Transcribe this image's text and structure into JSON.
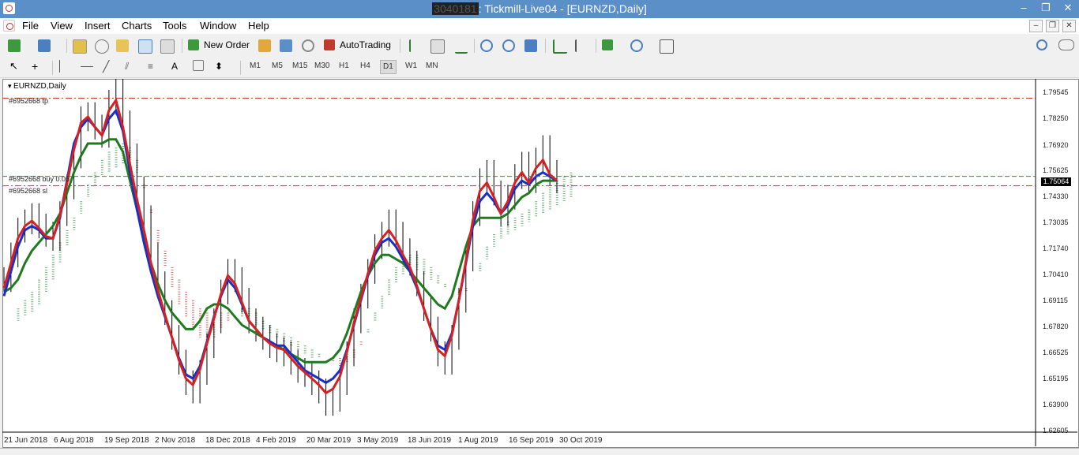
{
  "window": {
    "title_redacted": "3040181",
    "title_rest": ": Tickmill-Live04 - [EURNZD,Daily]",
    "minimize": "–",
    "maximize": "❐",
    "close": "✕"
  },
  "menu": [
    "File",
    "View",
    "Insert",
    "Charts",
    "Tools",
    "Window",
    "Help"
  ],
  "toolbar": {
    "new_order": "New Order",
    "autotrading": "AutoTrading"
  },
  "timeframes": [
    "M1",
    "M5",
    "M15",
    "M30",
    "H1",
    "H4",
    "D1",
    "W1",
    "MN"
  ],
  "active_timeframe": "D1",
  "colors": {
    "titlebar": "#5b8fc7",
    "tp_line": "#c0392b",
    "buy_line": "#2e8b3e",
    "sl_line": "#c0392b",
    "tenkan": "#d82020",
    "kijun": "#1a2fc7",
    "senkou": "#1f7a1f"
  },
  "chart_data": {
    "type": "line",
    "title": "EURNZD,Daily",
    "symbol": "EURNZD",
    "period": "Daily",
    "orders": [
      {
        "label": "#6952668 tp",
        "price": 1.788
      },
      {
        "label": "#6952668 buy 0.05",
        "price": 1.7501
      },
      {
        "label": "#6952668 sl",
        "price": 1.7455
      }
    ],
    "current_price": "1.75064",
    "price_ticks": [
      "1.79545",
      "1.78250",
      "1.76920",
      "1.75625",
      "1.74330",
      "1.73035",
      "1.71740",
      "1.70410",
      "1.69115",
      "1.67820",
      "1.66525",
      "1.65195",
      "1.63900",
      "1.62605"
    ],
    "date_ticks": [
      "21 Jun 2018",
      "6 Aug 2018",
      "19 Sep 2018",
      "2 Nov 2018",
      "18 Dec 2018",
      "4 Feb 2019",
      "20 Mar 2019",
      "3 May 2019",
      "18 Jun 2019",
      "1 Aug 2019",
      "16 Sep 2019",
      "30 Oct 2019"
    ],
    "ylim": [
      1.62605,
      1.79545
    ],
    "close_series": [
      1.7,
      1.712,
      1.724,
      1.728,
      1.731,
      1.726,
      1.722,
      1.72,
      1.732,
      1.745,
      1.76,
      1.778,
      1.78,
      1.774,
      1.77,
      1.786,
      1.792,
      1.776,
      1.76,
      1.744,
      1.73,
      1.712,
      1.698,
      1.684,
      1.672,
      1.66,
      1.65,
      1.646,
      1.655,
      1.668,
      1.68,
      1.694,
      1.704,
      1.7,
      1.69,
      1.68,
      1.676,
      1.672,
      1.668,
      1.666,
      1.664,
      1.66,
      1.656,
      1.654,
      1.65,
      1.646,
      1.64,
      1.642,
      1.65,
      1.664,
      1.68,
      1.692,
      1.704,
      1.716,
      1.722,
      1.728,
      1.722,
      1.714,
      1.708,
      1.698,
      1.686,
      1.676,
      1.664,
      1.66,
      1.672,
      1.69,
      1.71,
      1.732,
      1.748,
      1.752,
      1.742,
      1.732,
      1.74,
      1.75,
      1.756,
      1.748,
      1.758,
      1.764,
      1.752,
      1.748
    ],
    "tenkan_series": [
      1.692,
      1.704,
      1.716,
      1.724,
      1.726,
      1.724,
      1.72,
      1.72,
      1.73,
      1.748,
      1.766,
      1.774,
      1.778,
      1.774,
      1.77,
      1.778,
      1.782,
      1.772,
      1.752,
      1.734,
      1.718,
      1.704,
      1.692,
      1.682,
      1.672,
      1.662,
      1.654,
      1.652,
      1.658,
      1.67,
      1.682,
      1.692,
      1.7,
      1.696,
      1.688,
      1.68,
      1.676,
      1.672,
      1.67,
      1.668,
      1.668,
      1.664,
      1.66,
      1.656,
      1.654,
      1.652,
      1.65,
      1.652,
      1.656,
      1.666,
      1.678,
      1.69,
      1.702,
      1.712,
      1.718,
      1.72,
      1.716,
      1.71,
      1.704,
      1.696,
      1.686,
      1.676,
      1.668,
      1.666,
      1.674,
      1.69,
      1.708,
      1.726,
      1.738,
      1.742,
      1.738,
      1.732,
      1.736,
      1.744,
      1.748,
      1.746,
      1.75,
      1.752,
      1.75,
      1.748
    ],
    "kijun_series": [
      1.694,
      1.696,
      1.7,
      1.708,
      1.714,
      1.718,
      1.722,
      1.726,
      1.732,
      1.742,
      1.752,
      1.76,
      1.766,
      1.766,
      1.766,
      1.768,
      1.768,
      1.762,
      1.748,
      1.734,
      1.72,
      1.708,
      1.698,
      1.69,
      1.684,
      1.68,
      1.676,
      1.676,
      1.68,
      1.686,
      1.688,
      1.688,
      1.686,
      1.682,
      1.678,
      1.676,
      1.674,
      1.672,
      1.67,
      1.668,
      1.666,
      1.664,
      1.662,
      1.66,
      1.66,
      1.66,
      1.66,
      1.662,
      1.666,
      1.674,
      1.684,
      1.694,
      1.702,
      1.708,
      1.712,
      1.712,
      1.71,
      1.708,
      1.704,
      1.7,
      1.696,
      1.692,
      1.688,
      1.686,
      1.692,
      1.704,
      1.716,
      1.726,
      1.73,
      1.73,
      1.73,
      1.73,
      1.732,
      1.736,
      1.74,
      1.742,
      1.746,
      1.748,
      1.748,
      1.748
    ],
    "senkou_a": [
      1.686,
      1.69,
      1.694,
      1.7,
      1.706,
      1.712,
      1.718,
      1.724,
      1.73,
      1.738,
      1.746,
      1.752,
      1.758,
      1.762,
      1.764,
      1.766,
      1.764,
      1.758,
      1.746,
      1.732,
      1.718,
      1.706,
      1.696,
      1.688,
      1.682,
      1.676,
      1.672,
      1.67,
      1.672,
      1.676,
      1.68,
      1.684,
      1.686,
      1.686,
      1.684,
      1.68,
      1.678,
      1.676,
      1.674,
      1.672,
      1.67,
      1.668,
      1.666,
      1.664,
      1.662,
      1.66,
      1.658,
      1.66,
      1.662,
      1.668,
      1.676,
      1.684,
      1.692,
      1.7,
      1.706,
      1.71,
      1.712,
      1.712,
      1.71,
      1.706,
      1.702,
      1.698,
      1.694,
      1.692,
      1.694,
      1.7,
      1.708,
      1.716,
      1.722,
      1.726,
      1.728,
      1.73,
      1.732,
      1.734,
      1.738,
      1.742,
      1.746,
      1.748,
      1.75,
      1.752
    ],
    "senkou_b": [
      1.68,
      1.682,
      1.684,
      1.688,
      1.694,
      1.7,
      1.708,
      1.716,
      1.724,
      1.732,
      1.74,
      1.746,
      1.75,
      1.752,
      1.754,
      1.756,
      1.756,
      1.752,
      1.744,
      1.734,
      1.724,
      1.714,
      1.706,
      1.7,
      1.694,
      1.69,
      1.686,
      1.684,
      1.684,
      1.684,
      1.684,
      1.684,
      1.682,
      1.68,
      1.678,
      1.676,
      1.674,
      1.672,
      1.67,
      1.668,
      1.666,
      1.664,
      1.662,
      1.662,
      1.662,
      1.662,
      1.662,
      1.664,
      1.666,
      1.67,
      1.674,
      1.68,
      1.686,
      1.692,
      1.698,
      1.702,
      1.704,
      1.704,
      1.702,
      1.7,
      1.698,
      1.696,
      1.694,
      1.694,
      1.696,
      1.7,
      1.704,
      1.71,
      1.716,
      1.72,
      1.722,
      1.724,
      1.726,
      1.728,
      1.73,
      1.732,
      1.734,
      1.736,
      1.738,
      1.74
    ],
    "grid": false,
    "legend": "none"
  }
}
